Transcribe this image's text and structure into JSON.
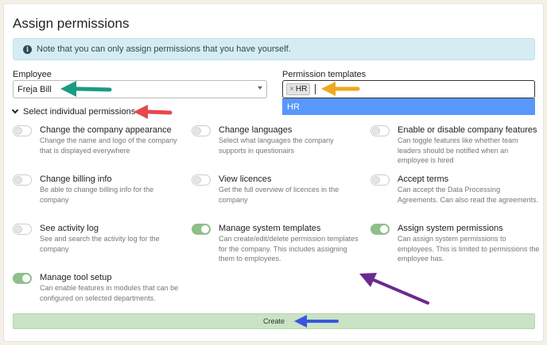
{
  "title": "Assign permissions",
  "note": {
    "icon": "info-icon",
    "text": "Note that you can only assign permissions that you have yourself."
  },
  "employee": {
    "label": "Employee",
    "value": "Freja Bill"
  },
  "templates": {
    "label": "Permission templates",
    "tag": "HR",
    "tag_remove": "×",
    "option": "HR"
  },
  "section": {
    "label": "Select individual permissions"
  },
  "permissions": [
    {
      "title": "Change the company appearance",
      "desc": "Change the name and logo of the company that is displayed everywhere",
      "on": false
    },
    {
      "title": "Change languages",
      "desc": "Select what languages the company supports in questionairs",
      "on": false
    },
    {
      "title": "Enable or disable company features",
      "desc": "Can toggle features like whether team leaders should be notified when an employee is hired",
      "on": false
    },
    {
      "title": "Change billing info",
      "desc": "Be able to change billing info for the company",
      "on": false
    },
    {
      "title": "View licences",
      "desc": "Get the full overview of licences in the company",
      "on": false
    },
    {
      "title": "Accept terms",
      "desc": "Can accept the Data Processing Agreements. Can also read the agreements.",
      "on": false
    },
    {
      "title": "See activity log",
      "desc": "See and search the activity log for the company",
      "on": false
    },
    {
      "title": "Manage system templates",
      "desc": "Can create/edit/delete permission templates for the company. This includes assigning them to employees.",
      "on": true
    },
    {
      "title": "Assign system permissions",
      "desc": "Can assign system permissions to employees. This is limited to permissions the employee has.",
      "on": true
    },
    {
      "title": "Manage tool setup",
      "desc": "Can enable features in modules that can be configured on selected departments.",
      "on": true
    }
  ],
  "create_label": "Create",
  "colors": {
    "toggle_on": "#8fbf8a",
    "dropdown_highlight": "#5897fb",
    "note_bg": "#d5ecf2",
    "create_bg": "#c9e3c4",
    "arrow_green": "#1a9c84",
    "arrow_red": "#e5484d",
    "arrow_orange": "#f0a81e",
    "arrow_purple": "#6b2a8f",
    "arrow_blue": "#3a55e0"
  }
}
